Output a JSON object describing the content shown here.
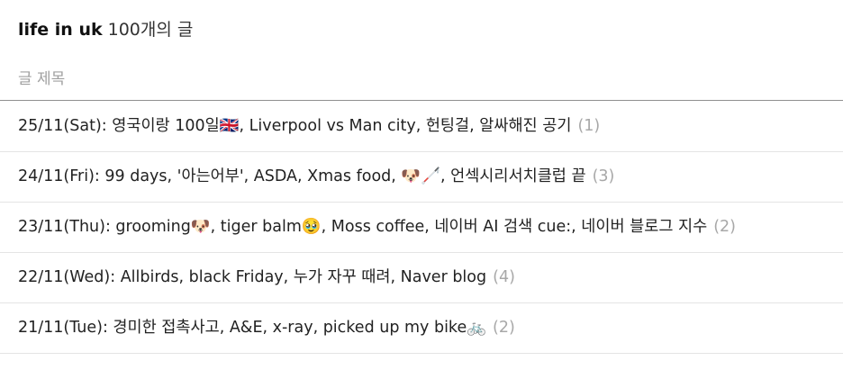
{
  "category": {
    "name": "life in uk",
    "post_count": "100개의 글"
  },
  "list_header": {
    "title_label": "글 제목"
  },
  "posts": [
    {
      "title": "25/11(Sat): 영국이랑 100일🇬🇧, Liverpool vs Man city, 헌팅걸, 알싸해진 공기",
      "comments": "(1)"
    },
    {
      "title": "24/11(Fri): 99 days, '아는어부', ASDA, Xmas food, 🐶🦯, 언섹시리서치클럽 끝",
      "comments": "(3)"
    },
    {
      "title": "23/11(Thu): grooming🐶, tiger balm🥹, Moss coffee, 네이버 AI 검색 cue:, 네이버 블로그 지수",
      "comments": "(2)"
    },
    {
      "title": "22/11(Wed): Allbirds, black Friday, 누가 자꾸 때려, Naver blog",
      "comments": "(4)"
    },
    {
      "title": "21/11(Tue): 경미한 접촉사고, A&E, x-ray, picked up my bike🚲",
      "comments": "(2)"
    }
  ]
}
